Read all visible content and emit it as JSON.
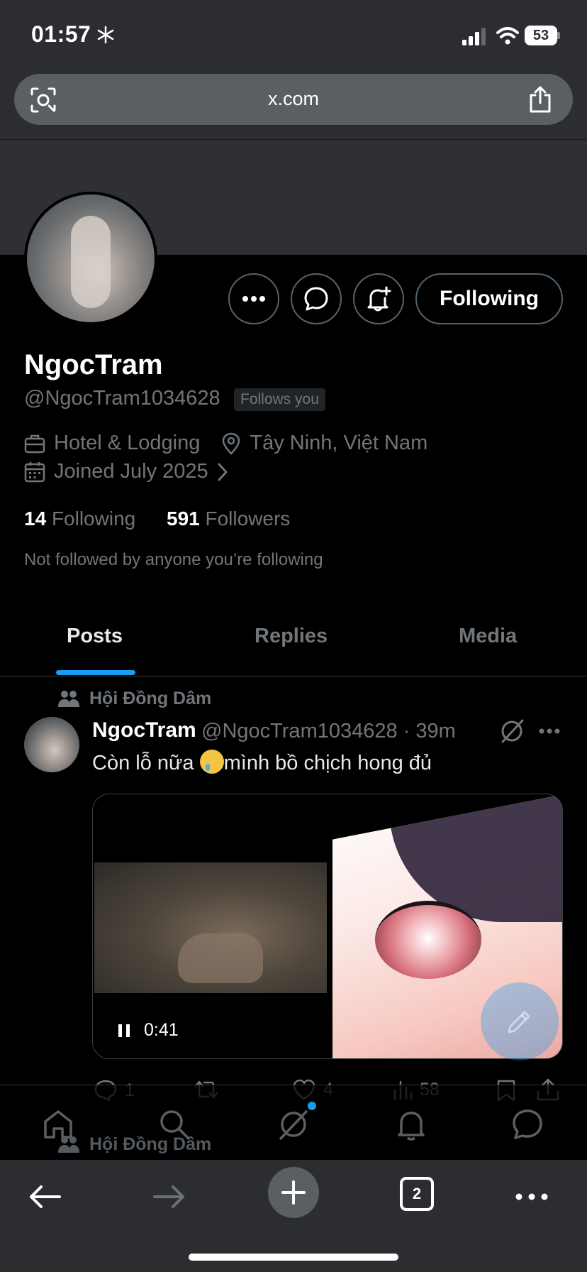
{
  "status": {
    "time": "01:57",
    "battery": "53"
  },
  "browser": {
    "url": "x.com",
    "tab_count": "2"
  },
  "profile": {
    "name": "NgocTram",
    "handle": "@NgocTram1034628",
    "follows_you": "Follows you",
    "category": "Hotel & Lodging",
    "location": "Tây Ninh, Việt Nam",
    "joined": "Joined July 2025",
    "following_count": "14",
    "following_label": "Following",
    "followers_count": "591",
    "followers_label": "Followers",
    "not_followed": "Not followed by anyone you’re following",
    "follow_button": "Following"
  },
  "tabs": [
    {
      "label": "Posts",
      "active": true
    },
    {
      "label": "Replies",
      "active": false
    },
    {
      "label": "Media",
      "active": false
    }
  ],
  "post": {
    "community": "Hội Đồng Dâm",
    "author": "NgocTram",
    "handle_time": "@NgocTram1034628 · 39m",
    "text_before": "Còn lỗ nữa ",
    "text_after": "mình bồ chịch hong đủ",
    "video_duration": "0:41",
    "replies": "1",
    "likes": "4",
    "views": "58"
  },
  "next_post": {
    "community": "Hội Đồng Dâm"
  },
  "icons": [
    "snowflake-icon",
    "signal-icon",
    "wifi-icon",
    "battery-icon",
    "lens-icon",
    "share-icon",
    "more-icon",
    "message-icon",
    "bell-plus-icon",
    "briefcase-icon",
    "location-icon",
    "calendar-icon",
    "chevron-right-icon",
    "community-icon",
    "grok-icon",
    "reply-icon",
    "repost-icon",
    "like-icon",
    "views-icon",
    "bookmark-icon",
    "home-icon",
    "search-icon",
    "bell-icon",
    "chat-icon",
    "back-icon",
    "forward-icon",
    "plus-icon",
    "tabs-icon"
  ],
  "colors": {
    "accent": "#1d9bf0",
    "muted": "#71767b",
    "background": "#000000",
    "chrome": "#2b2d31"
  }
}
